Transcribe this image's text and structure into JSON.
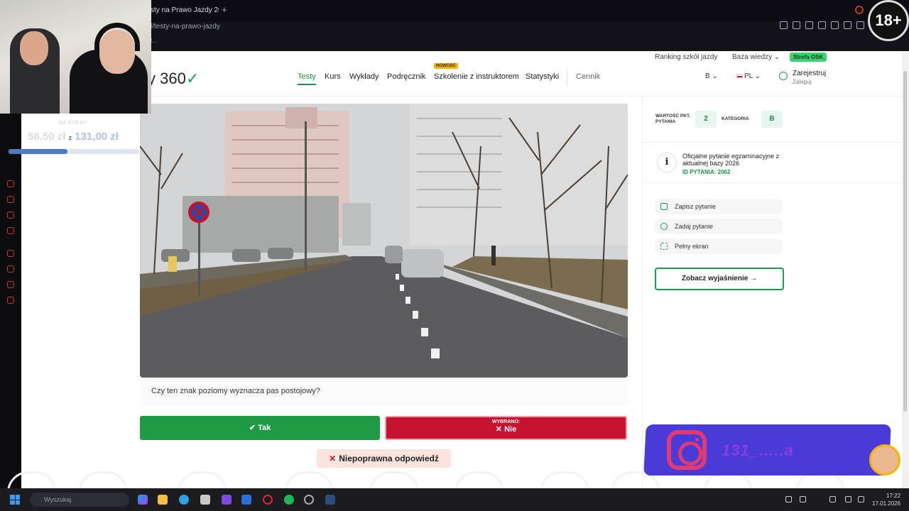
{
  "browser": {
    "tab_title": "sty na Prawo Jazdy 202",
    "new_tab": "+",
    "url": "l/testy-na-prawo-jazdy",
    "bookmarks": "t..."
  },
  "badge": "18+",
  "donation": {
    "title": "NA RUCHY",
    "current": "58,50 zł",
    "separator": "z",
    "goal": "131,00 zł",
    "progress": 0.45
  },
  "topnav": {
    "ranking": "Ranking szkół jazdy",
    "baza": "Baza wiedzy",
    "osk": "Strefa OSK"
  },
  "logo": {
    "text_prefix": "y 360"
  },
  "nav": {
    "items": [
      "Testy",
      "Kurs",
      "Wykłady",
      "Podręcznik",
      "Szkolenie z instruktorem",
      "Statystyki"
    ],
    "new_badge": "NOWOŚĆ",
    "pricing": "Cennik",
    "category": "B",
    "language": "PL",
    "register": "Zarejestruj",
    "login": "Zaloguj"
  },
  "question": {
    "text": "Czy ten znak poziomy wyznacza pas postojowy?",
    "yes_label": "Tak",
    "selected_prefix": "WYBRANO:",
    "no_label": "Nie",
    "result": "Niepoprawna odpowiedź"
  },
  "panel": {
    "points_label_1": "WARTOŚĆ PKT.",
    "points_label_2": "PYTANIA",
    "points_value": "2",
    "category_label": "KATEGORIA",
    "category_value": "B",
    "info_text": "Oficjalne pytanie egzaminacyjne z aktualnej bazy 2026",
    "question_id": "ID PYTANIA: 2062",
    "actions": [
      "Zapisz pytanie",
      "Zadaj pytanie",
      "Pełny ekran"
    ],
    "explain": "Zobacz wyjaśnienie →"
  },
  "overlay": {
    "instagram_handle": "131_.....a"
  },
  "taskbar": {
    "search_placeholder": "Wyszukaj",
    "time": "17:22",
    "date": "17.01.2026"
  },
  "colors": {
    "accent_green": "#1f9a45",
    "wrong_red": "#c4122f",
    "osk_green": "#3bd16f"
  }
}
